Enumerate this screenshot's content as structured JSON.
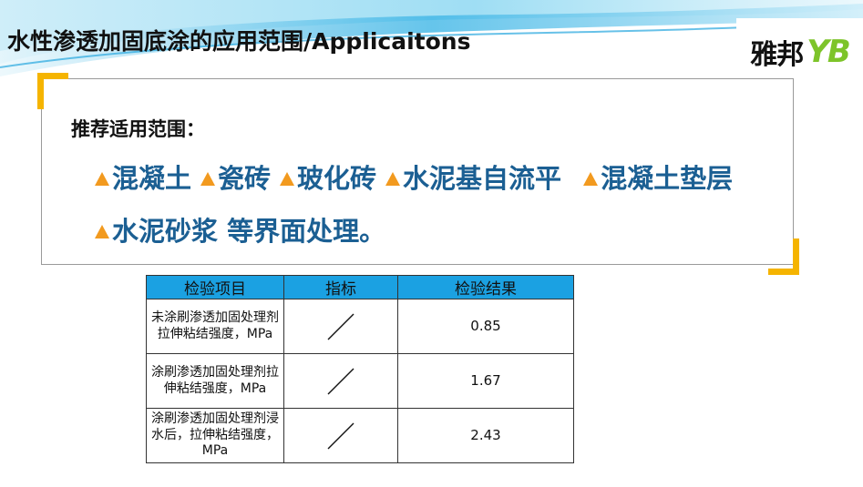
{
  "slide": {
    "title": "水性渗透加固底涂的应用范围/Applicaitons"
  },
  "logo": {
    "cn": "雅邦",
    "en": "YB"
  },
  "applications": {
    "heading": "推荐适用范围：",
    "row1": [
      "混凝土",
      "瓷砖",
      "玻化砖",
      "水泥基自流平",
      "混凝土垫层"
    ],
    "row2": [
      "水泥砂浆 等界面处理。"
    ]
  },
  "table": {
    "headers": [
      "检验项目",
      "指标",
      "检验结果"
    ],
    "rows": [
      {
        "item": "未涂刷渗透加固处理剂拉伸粘结强度，MPa",
        "indicator_icon": "slash-icon",
        "result": "0.85"
      },
      {
        "item": "涂刷渗透加固处理剂拉伸粘结强度，MPa",
        "indicator_icon": "slash-icon",
        "result": "1.67"
      },
      {
        "item": "涂刷渗透加固处理剂浸水后，拉伸粘结强度，MPa",
        "indicator_icon": "slash-icon",
        "result": "2.43"
      }
    ]
  },
  "colors": {
    "accent_blue": "#1b5f93",
    "header_blue": "#1ba1e2",
    "bracket_yellow": "#f5b400",
    "triangle_orange": "#f29a1f",
    "logo_green": "#7dc42a"
  }
}
